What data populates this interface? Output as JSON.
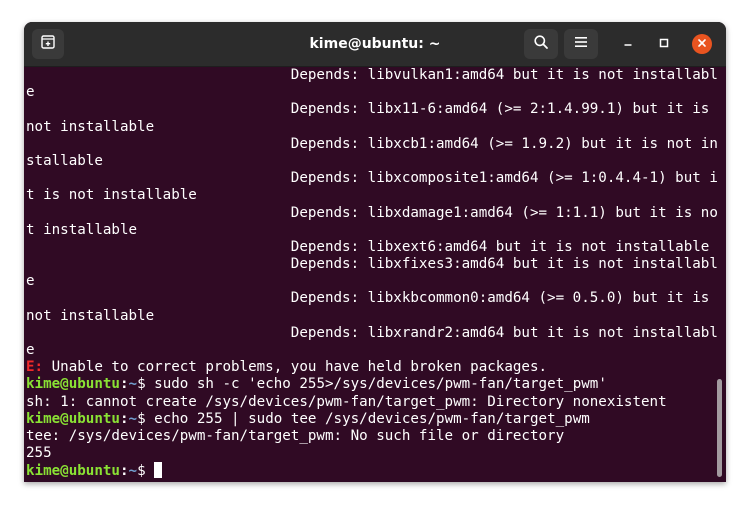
{
  "window": {
    "title": "kime@ubuntu: ~"
  },
  "titlebar": {
    "icons": {
      "new_tab": "new-tab-icon",
      "search": "search-icon",
      "menu": "hamburger-menu-icon",
      "minimize": "minimize-icon",
      "maximize": "maximize-icon",
      "close": "close-icon"
    }
  },
  "colors": {
    "terminal_bg": "#300a24",
    "titlebar_bg": "#2c2c2c",
    "prompt_user": "#8ae234",
    "prompt_path": "#729fcf",
    "error": "#ef2929",
    "close_button": "#e95420"
  },
  "terminal": {
    "lines": [
      "                               Depends: libvulkan1:amd64 but it is not installabl",
      "e",
      "                               Depends: libx11-6:amd64 (>= 2:1.4.99.1) but it is",
      "not installable",
      "                               Depends: libxcb1:amd64 (>= 1.9.2) but it is not in",
      "stallable",
      "                               Depends: libxcomposite1:amd64 (>= 1:0.4.4-1) but i",
      "t is not installable",
      "                               Depends: libxdamage1:amd64 (>= 1:1.1) but it is no",
      "t installable",
      "                               Depends: libxext6:amd64 but it is not installable",
      "                               Depends: libxfixes3:amd64 but it is not installabl",
      "e",
      "                               Depends: libxkbcommon0:amd64 (>= 0.5.0) but it is",
      "not installable",
      "                               Depends: libxrandr2:amd64 but it is not installabl",
      "e"
    ],
    "error_line": {
      "prefix": "E:",
      "message": " Unable to correct problems, you have held broken packages."
    },
    "prompt": {
      "user_host": "kime@ubuntu",
      "separator": ":",
      "path": "~",
      "symbol": "$ "
    },
    "commands": [
      {
        "command": "sudo sh -c 'echo 255>/sys/devices/pwm-fan/target_pwm'",
        "output": [
          "sh: 1: cannot create /sys/devices/pwm-fan/target_pwm: Directory nonexistent"
        ]
      },
      {
        "command": "echo 255 | sudo tee /sys/devices/pwm-fan/target_pwm",
        "output": [
          "tee: /sys/devices/pwm-fan/target_pwm: No such file or directory",
          "255"
        ]
      }
    ]
  }
}
